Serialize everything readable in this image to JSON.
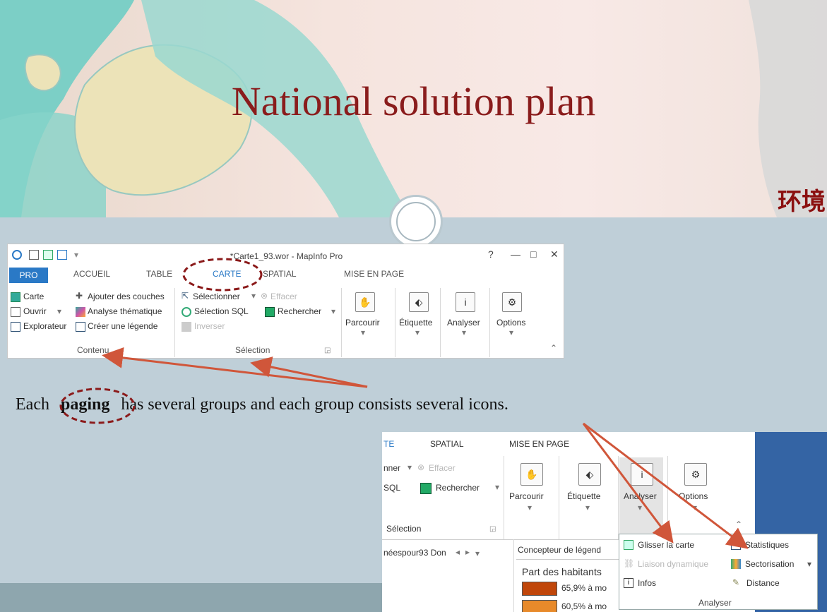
{
  "slide": {
    "title": "National solution plan",
    "chinese_text": "环境",
    "caption_before": "Each",
    "caption_highlight": "paging",
    "caption_after": "has several groups and each group consists several icons."
  },
  "ribbon1": {
    "window_title": "*Carte1_93.wor - MapInfo Pro",
    "window_controls": [
      "?",
      "—",
      "□",
      "✕"
    ],
    "tabs": [
      "PRO",
      "ACCUEIL",
      "TABLE",
      "CARTE",
      "SPATIAL",
      "MISE EN PAGE"
    ],
    "contenu": {
      "items": [
        "Carte",
        "Ouvrir",
        "Explorateur",
        "Ajouter des couches",
        "Analyse thématique",
        "Créer une légende"
      ],
      "group_label": "Contenu"
    },
    "selection": {
      "items": [
        "Sélectionner",
        "Effacer",
        "Sélection SQL",
        "Rechercher",
        "Inverser"
      ],
      "group_label": "Sélection"
    },
    "big_buttons": [
      "Parcourir",
      "Étiquette",
      "Analyser",
      "Options"
    ]
  },
  "ribbon2": {
    "tabs": [
      "TE",
      "SPATIAL",
      "MISE EN PAGE"
    ],
    "partial_items": [
      "nner",
      "Effacer",
      "SQL",
      "Rechercher"
    ],
    "group_label": "Sélection",
    "big_buttons": [
      "Parcourir",
      "Étiquette",
      "Analyser",
      "Options"
    ],
    "doc_tab": "néespour93 Don",
    "legend_panel_title": "Concepteur de légend",
    "legend_heading": "Part des habitants",
    "legend_rows": [
      "65,9% à mo",
      "60,5% à mo"
    ],
    "legend_colors": [
      "#c0460a",
      "#e88a2a"
    ]
  },
  "dropdown": {
    "items": [
      "Glisser la carte",
      "Statistiques",
      "Liaison dynamique",
      "Sectorisation",
      "Infos",
      "Distance"
    ],
    "group_label": "Analyser"
  },
  "colors": {
    "accent": "#2a79c6",
    "title_red": "#8a1c1c",
    "arrow": "#d0563a"
  }
}
